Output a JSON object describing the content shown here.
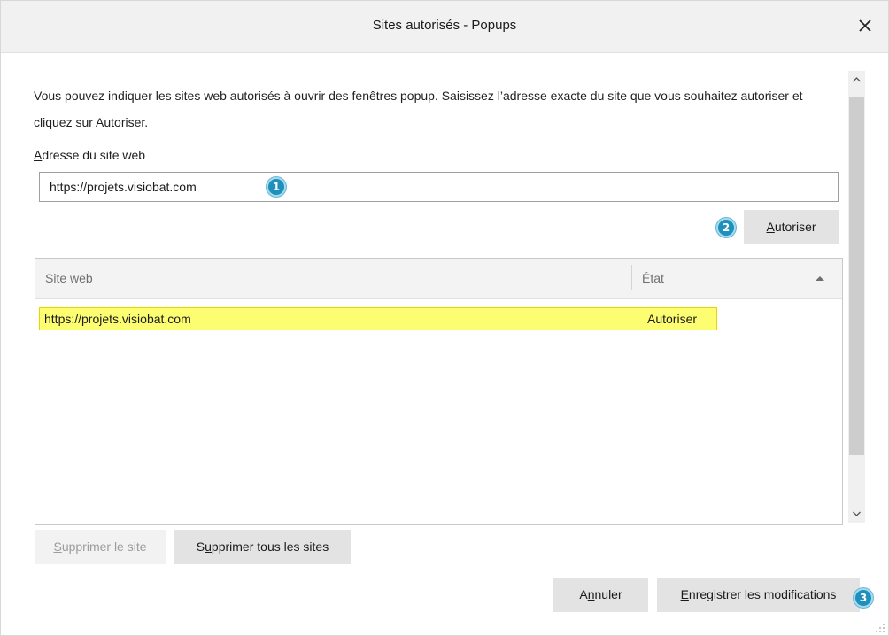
{
  "window": {
    "title": "Sites autorisés - Popups"
  },
  "description": "Vous pouvez indiquer les sites web autorisés à ouvrir des fenêtres popup. Saisissez l’adresse exacte du site que vous souhaitez autoriser et cliquez sur Autoriser.",
  "address_field": {
    "label_first": "A",
    "label_rest": "dresse du site web",
    "value": "https://projets.visiobat.com",
    "placeholder": ""
  },
  "buttons": {
    "allow_first": "A",
    "allow_rest": "utoriser",
    "remove_site_first": "S",
    "remove_site_rest": "upprimer le site",
    "remove_all_first": "S",
    "remove_all_mid": "u",
    "remove_all_rest": "pprimer tous les sites",
    "cancel_first": "A",
    "cancel_mid": "n",
    "cancel_rest": "nuler",
    "save_first": "E",
    "save_rest": "nregistrer les modifications"
  },
  "table": {
    "columns": [
      "Site web",
      "État"
    ],
    "rows": [
      {
        "site": "https://projets.visiobat.com",
        "state": "Autoriser"
      }
    ]
  },
  "annotations": [
    "1",
    "2",
    "3"
  ],
  "colors": {
    "highlight": "#fdfd72",
    "badge": "#1f8fbc",
    "button": "#e3e3e3"
  },
  "icons": [
    "close-icon",
    "sort-ascending-icon",
    "scroll-up-icon",
    "scroll-down-icon",
    "resize-grip-icon"
  ]
}
